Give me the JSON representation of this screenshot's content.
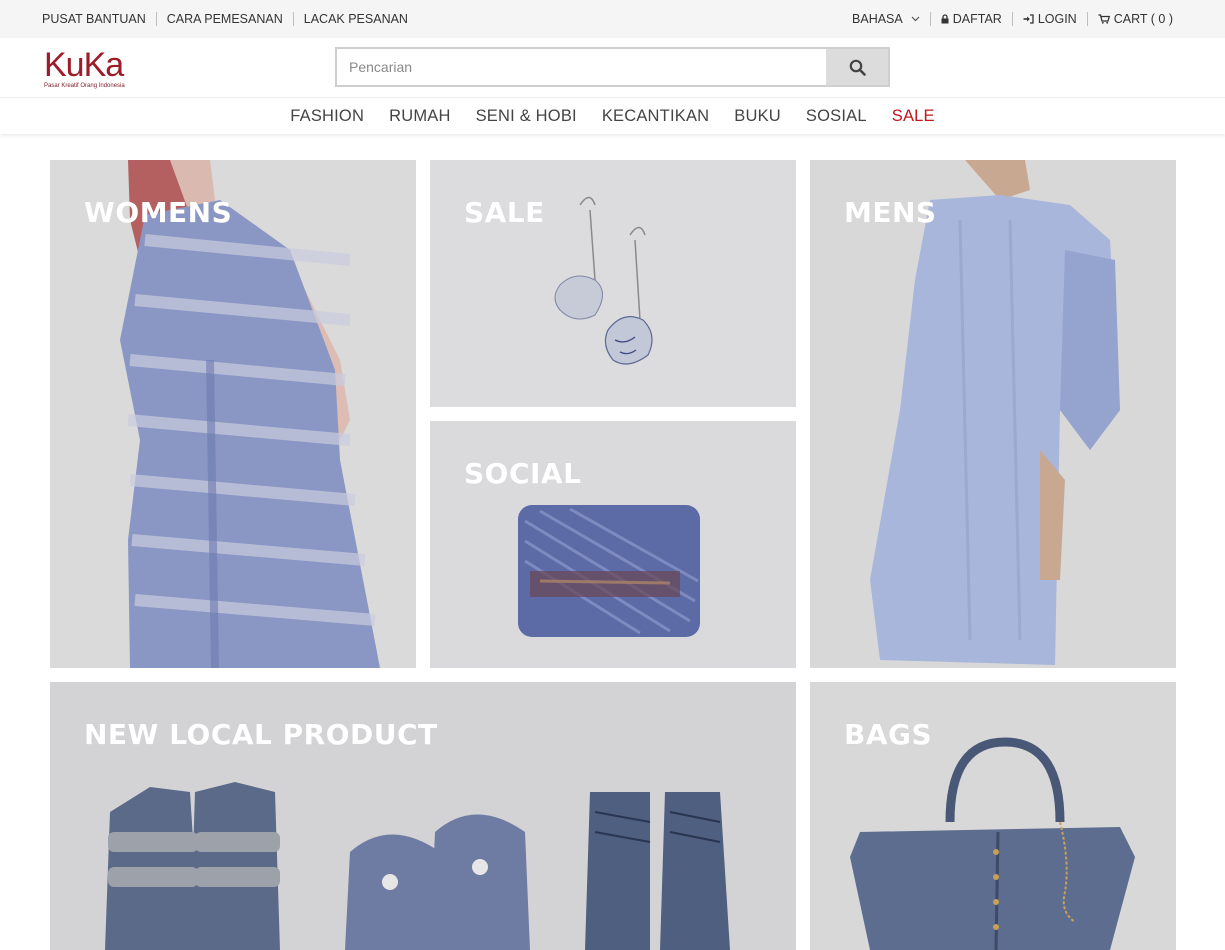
{
  "topbar": {
    "left_links": [
      "PUSAT BANTUAN",
      "CARA PEMESANAN",
      "LACAK PESANAN"
    ],
    "language_label": "BAHASA",
    "register_label": "DAFTAR",
    "login_label": "LOGIN",
    "cart_label": "CART ( 0 )"
  },
  "header": {
    "logo_text": "KuKa",
    "logo_tagline": "Pasar Kreatif Orang Indonesia",
    "search_placeholder": "Pencarian"
  },
  "nav": {
    "items": [
      "FASHION",
      "RUMAH",
      "SENI & HOBI",
      "KECANTIKAN",
      "BUKU",
      "SOSIAL",
      "SALE"
    ]
  },
  "tiles": {
    "womens": "WOMENS",
    "sale": "SALE",
    "social": "SOCIAL",
    "mens": "MENS",
    "new_local": "NEW LOCAL PRODUCT",
    "bags": "BAGS"
  },
  "colors": {
    "brand": "#9c1c2a",
    "sale_accent": "#c0161c",
    "tile_bg": "#d8d8d8",
    "topbar_bg": "#f5f5f5"
  },
  "icons": {
    "language": "chevron-down-icon",
    "register": "lock-icon",
    "login": "sign-in-icon",
    "cart": "cart-icon",
    "search": "search-icon"
  }
}
